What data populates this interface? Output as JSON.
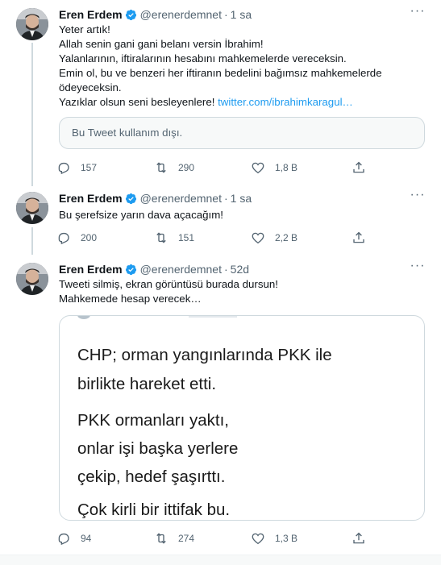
{
  "colors": {
    "link": "#1d9bf0",
    "verified": "#1d9bf0",
    "muted": "#536471",
    "thread_line": "#cfd9de"
  },
  "tweets": [
    {
      "name": "Eren Erdem",
      "handle": "@erenerdemnet",
      "dot": "·",
      "time": "1 sa",
      "lines": [
        "Yeter artık!",
        "Allah senin gani gani belanı versin İbrahim!",
        "Yalanlarının, iftiralarının hesabını mahkemelerde vereceksin.",
        "Emin ol, bu ve benzeri her iftiranın bedelini bağımsız mahkemelerde",
        "ödeyeceksin.",
        "Yazıklar olsun seni besleyenlere! "
      ],
      "link": "twitter.com/ibrahimkaragul…",
      "unavailable": "Bu Tweet kullanım dışı.",
      "replies": "157",
      "retweets": "290",
      "likes": "1,8 B"
    },
    {
      "name": "Eren Erdem",
      "handle": "@erenerdemnet",
      "dot": "·",
      "time": "1 sa",
      "lines": [
        "Bu şerefsize yarın dava açacağım!"
      ],
      "replies": "200",
      "retweets": "151",
      "likes": "2,2 B"
    },
    {
      "name": "Eren Erdem",
      "handle": "@erenerdemnet",
      "dot": "·",
      "time": "52d",
      "lines": [
        "Tweeti silmiş, ekran görüntüsü burada dursun!",
        "Mahkemede hesap verecek…"
      ],
      "image_text": [
        "CHP; orman yangınlarında PKK ile",
        "birlikte hareket etti.",
        "PKK ormanları yaktı,",
        "onlar işi başka yerlere",
        "çekip, hedef şaşırttı.",
        "Çok kirli bir ittifak bu."
      ],
      "replies": "94",
      "retweets": "274",
      "likes": "1,3 B"
    }
  ],
  "icons": {
    "more": "more-icon",
    "reply": "reply-icon",
    "retweet": "retweet-icon",
    "like": "like-icon",
    "share": "share-icon",
    "verified": "verified-icon"
  }
}
